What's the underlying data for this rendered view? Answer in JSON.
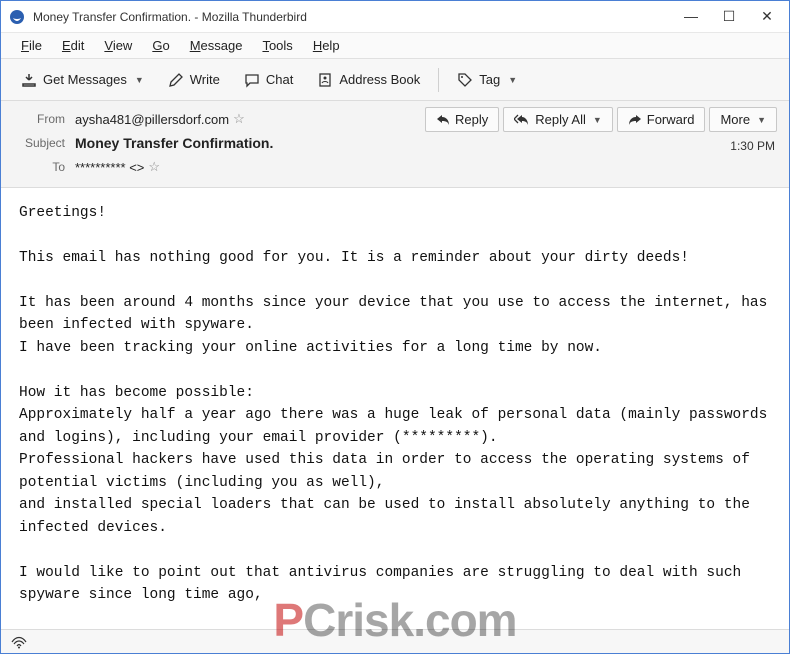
{
  "window": {
    "title": "Money Transfer Confirmation. - Mozilla Thunderbird"
  },
  "menubar": {
    "file": "File",
    "edit": "Edit",
    "view": "View",
    "go": "Go",
    "message": "Message",
    "tools": "Tools",
    "help": "Help"
  },
  "toolbar": {
    "get_messages": "Get Messages",
    "write": "Write",
    "chat": "Chat",
    "address_book": "Address Book",
    "tag": "Tag"
  },
  "header": {
    "from_label": "From",
    "from_value": "aysha481@pillersdorf.com",
    "subject_label": "Subject",
    "subject_value": "Money Transfer Confirmation.",
    "to_label": "To",
    "to_value": "********** <>",
    "time": "1:30 PM"
  },
  "actions": {
    "reply": "Reply",
    "reply_all": "Reply All",
    "forward": "Forward",
    "more": "More"
  },
  "body": {
    "text": "Greetings!\n\nThis email has nothing good for you. It is a reminder about your dirty deeds!\n\nIt has been around 4 months since your device that you use to access the internet, has been infected with spyware.\nI have been tracking your online activities for a long time by now.\n\nHow it has become possible:\nApproximately half a year ago there was a huge leak of personal data (mainly passwords and logins), including your email provider (*********).\nProfessional hackers have used this data in order to access the operating systems of potential victims (including you as well),\nand installed special loaders that can be used to install absolutely anything to the infected devices.\n\nI would like to point out that antivirus companies are struggling to deal with such spyware since long time ago,\nbecause Trojan software codes keep continuously updating and hence, not allowing antiviruses to do anything."
  },
  "watermark": {
    "p": "P",
    "c": "C",
    "rest": "risk.com"
  }
}
